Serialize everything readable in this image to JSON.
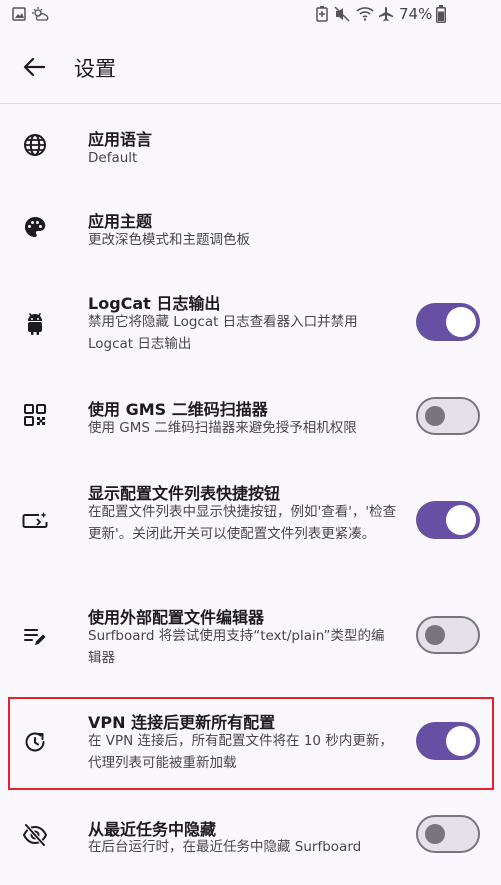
{
  "status_bar": {
    "battery": "74%"
  },
  "header": {
    "title": "设置"
  },
  "settings": [
    {
      "title": "应用语言",
      "subtitle": "Default",
      "icon": "globe-icon"
    },
    {
      "title": "应用主题",
      "subtitle": "更改深色模式和主题调色板",
      "icon": "palette-icon"
    },
    {
      "title": "LogCat 日志输出",
      "subtitle": "禁用它将隐藏 Logcat 日志查看器入口并禁用 Logcat 日志输出",
      "icon": "android-icon",
      "switch": "on"
    },
    {
      "title": "使用 GMS 二维码扫描器",
      "subtitle": "使用 GMS 二维码扫描器来避免授予相机权限",
      "icon": "qr-code-icon",
      "switch": "off"
    },
    {
      "title": "显示配置文件列表快捷按钮",
      "subtitle": "在配置文件列表中显示快捷按钮，例如'查看'，'检查更新'。关闭此开关可以使配置文件列表更紧凑。",
      "icon": "shortcut-button-icon",
      "switch": "on"
    },
    {
      "title": "使用外部配置文件编辑器",
      "subtitle": "Surfboard 将尝试使用支持“text/plain”类型的编辑器",
      "icon": "edit-note-icon",
      "switch": "off"
    },
    {
      "title": "VPN 连接后更新所有配置",
      "subtitle": "在 VPN 连接后，所有配置文件将在 10 秒内更新，代理列表可能被重新加载",
      "icon": "update-icon",
      "switch": "on"
    },
    {
      "title": "从最近任务中隐藏",
      "subtitle": "在后台运行时，在最近任务中隐藏 Surfboard",
      "icon": "visibility-off-icon",
      "switch": "off"
    }
  ],
  "colors": {
    "accent": "#6750a4",
    "highlight": "#e5212b",
    "background": "#fbf8fd"
  }
}
